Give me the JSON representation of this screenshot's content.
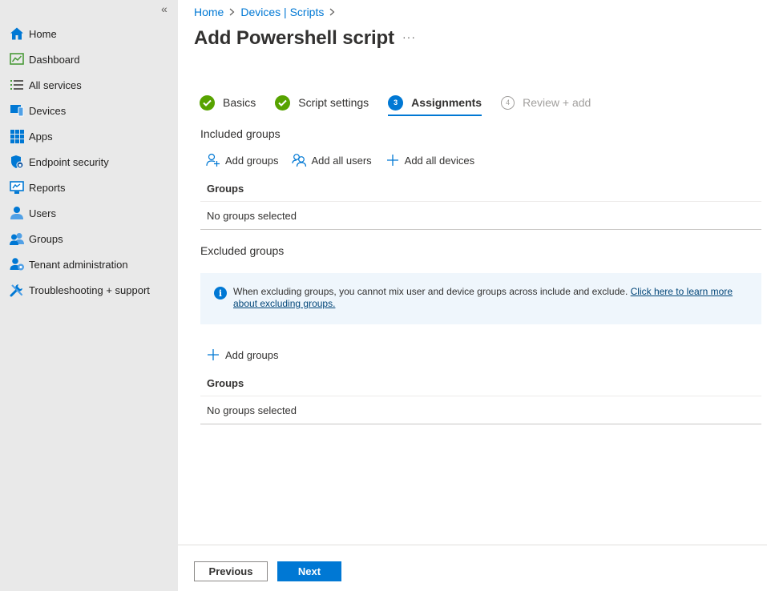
{
  "sidebar": {
    "collapse_glyph": "«",
    "items": [
      {
        "label": "Home",
        "icon": "home-icon"
      },
      {
        "label": "Dashboard",
        "icon": "dashboard-icon"
      },
      {
        "label": "All services",
        "icon": "list-icon"
      },
      {
        "label": "Devices",
        "icon": "devices-icon"
      },
      {
        "label": "Apps",
        "icon": "apps-icon"
      },
      {
        "label": "Endpoint security",
        "icon": "shield-icon"
      },
      {
        "label": "Reports",
        "icon": "reports-icon"
      },
      {
        "label": "Users",
        "icon": "user-icon"
      },
      {
        "label": "Groups",
        "icon": "groups-icon"
      },
      {
        "label": "Tenant administration",
        "icon": "tenant-admin-icon"
      },
      {
        "label": "Troubleshooting + support",
        "icon": "wrench-icon"
      }
    ]
  },
  "breadcrumb": {
    "items": [
      "Home",
      "Devices | Scripts"
    ],
    "separator": ">"
  },
  "page": {
    "title": "Add Powershell script",
    "more": "···"
  },
  "steps": [
    {
      "number": "1",
      "label": "Basics",
      "state": "done"
    },
    {
      "number": "2",
      "label": "Script settings",
      "state": "done"
    },
    {
      "number": "3",
      "label": "Assignments",
      "state": "active"
    },
    {
      "number": "4",
      "label": "Review + add",
      "state": "future"
    }
  ],
  "included": {
    "title": "Included groups",
    "actions": {
      "add_groups": "Add groups",
      "add_all_users": "Add all users",
      "add_all_devices": "Add all devices"
    },
    "column": "Groups",
    "empty": "No groups selected"
  },
  "excluded": {
    "title": "Excluded groups",
    "info_text": "When excluding groups, you cannot mix user and device groups across include and exclude. ",
    "info_link_line1": "Click here to learn more ",
    "info_link_line2": "about excluding groups.",
    "add_groups": "Add groups",
    "column": "Groups",
    "empty": "No groups selected"
  },
  "footer": {
    "previous": "Previous",
    "next": "Next"
  },
  "colors": {
    "accent": "#0078d4",
    "success": "#57a300",
    "sidebar_bg": "#e9e9e9",
    "info_bg": "#eff6fc"
  }
}
